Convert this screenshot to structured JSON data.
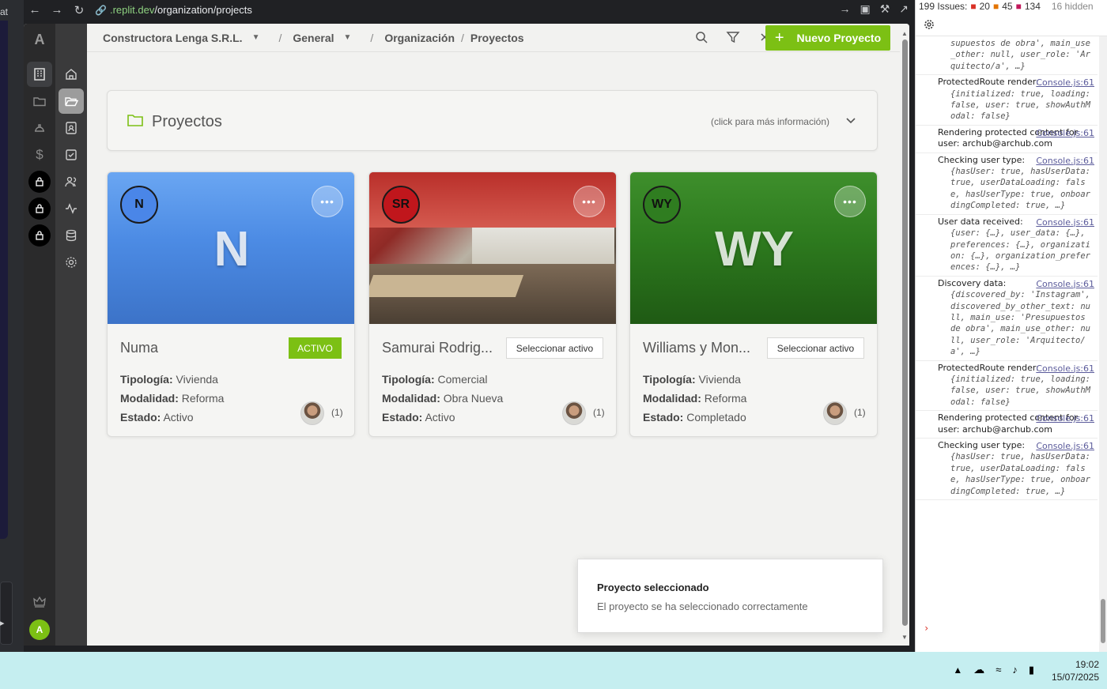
{
  "browser": {
    "left_tab_text": "at",
    "url_host": ".replit.dev",
    "url_path": "/organization/projects"
  },
  "sidebar": {
    "logo": "A",
    "user_initial": "A"
  },
  "header": {
    "org": "Constructora Lenga S.R.L.",
    "space": "General",
    "section": "Organización",
    "page": "Proyectos",
    "new_button": "Nuevo Proyecto"
  },
  "panel": {
    "title": "Proyectos",
    "hint": "(click para más información)"
  },
  "labels": {
    "typology": "Tipología:",
    "modality": "Modalidad:",
    "status": "Estado:"
  },
  "projects": [
    {
      "initials": "N",
      "hero_text": "N",
      "hero_style": "blue",
      "name": "Numa",
      "action": "ACTIVO",
      "active": true,
      "typology": "Vivienda",
      "modality": "Reforma",
      "status": "Activo",
      "members": "(1)",
      "avatar_color": "#4a86e8"
    },
    {
      "initials": "SR",
      "hero_text": "",
      "hero_style": "photo",
      "name": "Samurai Rodrig...",
      "action": "Seleccionar activo",
      "active": false,
      "typology": "Comercial",
      "modality": "Obra Nueva",
      "status": "Activo",
      "members": "(1)",
      "avatar_color": "#c0161c"
    },
    {
      "initials": "WY",
      "hero_text": "WY",
      "hero_style": "green",
      "name": "Williams y Mon...",
      "action": "Seleccionar activo",
      "active": false,
      "typology": "Vivienda",
      "modality": "Reforma",
      "status": "Completado",
      "members": "(1)",
      "avatar_color": "#2f7d20"
    }
  ],
  "toast": {
    "title": "Proyecto seleccionado",
    "message": "El proyecto se ha seleccionado correctamente"
  },
  "devtools": {
    "issues_label": "199 Issues:",
    "errors": "20",
    "warnings": "45",
    "info": "134",
    "hidden": "16 hidden",
    "entries": [
      {
        "msg": "",
        "src": "",
        "obj": "supuestos de obra', main_use_other: null, user_role: 'Arquitecto/a', …}"
      },
      {
        "msg": "ProtectedRoute render:",
        "src": "Console.js:61",
        "obj": "{initialized: true, loading: false, user: true, showAuthModal: false}"
      },
      {
        "msg": "Rendering protected content for user: archub@archub.com",
        "src": "Console.js:61",
        "obj": ""
      },
      {
        "msg": "Checking user type:",
        "src": "Console.js:61",
        "obj": "{hasUser: true, hasUserData: true, userDataLoading: false, hasUserType: true, onboardingCompleted: true, …}"
      },
      {
        "msg": "User data received:",
        "src": "Console.js:61",
        "obj": "{user: {…}, user_data: {…}, preferences: {…}, organization: {…}, organization_preferences: {…}, …}"
      },
      {
        "msg": "Discovery data:",
        "src": "Console.js:61",
        "obj": "{discovered_by: 'Instagram', discovered_by_other_text: null, main_use: 'Presupuestos de obra', main_use_other: null, user_role: 'Arquitecto/a', …}"
      },
      {
        "msg": "ProtectedRoute render:",
        "src": "Console.js:61",
        "obj": "{initialized: true, loading: false, user: true, showAuthModal: false}"
      },
      {
        "msg": "Rendering protected content for user: archub@archub.com",
        "src": "Console.js:61",
        "obj": ""
      },
      {
        "msg": "Checking user type:",
        "src": "Console.js:61",
        "obj": "{hasUser: true, hasUserData: true, userDataLoading: false, hasUserType: true, onboardingCompleted: true, …}"
      }
    ]
  },
  "taskbar": {
    "time": "19:02",
    "date": "15/07/2025"
  }
}
